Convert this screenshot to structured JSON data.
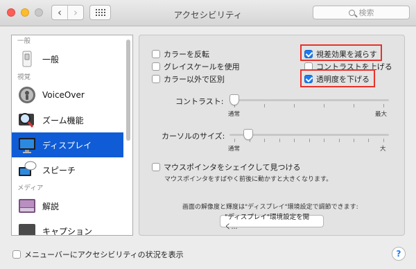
{
  "window": {
    "title": "アクセシビリティ"
  },
  "search": {
    "placeholder": "検索"
  },
  "sidebar": {
    "sections": [
      {
        "header": "一般",
        "items": [
          {
            "label": "一般",
            "icon": "switch-icon"
          }
        ]
      },
      {
        "header": "視覚",
        "items": [
          {
            "label": "VoiceOver",
            "icon": "voiceover-icon"
          },
          {
            "label": "ズーム機能",
            "icon": "zoom-icon"
          },
          {
            "label": "ディスプレイ",
            "icon": "display-icon",
            "selected": true
          },
          {
            "label": "スピーチ",
            "icon": "speech-icon"
          }
        ]
      },
      {
        "header": "メディア",
        "items": [
          {
            "label": "解説",
            "icon": "descriptions-icon"
          },
          {
            "label": "キャプション",
            "icon": "captions-icon"
          }
        ]
      }
    ]
  },
  "display": {
    "invert_colors": {
      "label": "カラーを反転",
      "checked": false
    },
    "grayscale": {
      "label": "グレイスケールを使用",
      "checked": false
    },
    "differentiate": {
      "label": "カラー以外で区別",
      "checked": false
    },
    "reduce_motion": {
      "label": "視差効果を減らす",
      "checked": true
    },
    "increase_contrast": {
      "label": "コントラストを上げる",
      "checked": false
    },
    "reduce_transparency": {
      "label": "透明度を下げる",
      "checked": true
    },
    "contrast": {
      "label": "コントラスト:",
      "min_label": "通常",
      "max_label": "最大",
      "value": 0.0
    },
    "cursor_size": {
      "label": "カーソルのサイズ:",
      "min_label": "通常",
      "max_label": "大",
      "value": 0.09
    },
    "shake_pointer": {
      "label": "マウスポインタをシェイクして見つける",
      "checked": false,
      "description": "マウスポインタをすばやく前後に動かすと大きくなります。"
    },
    "resolution_note": "画面の解像度と輝度は\"ディスプレイ\"環境設定で調節できます:",
    "open_display_button": "\"ディスプレイ\"環境設定を開く..."
  },
  "footer": {
    "menubar_checkbox": {
      "label": "メニューバーにアクセシビリティの状況を表示",
      "checked": false
    },
    "help": "?"
  },
  "colors": {
    "highlight": "#e8312a",
    "accent": "#1a7bf2",
    "selection": "#0f5cd6"
  }
}
